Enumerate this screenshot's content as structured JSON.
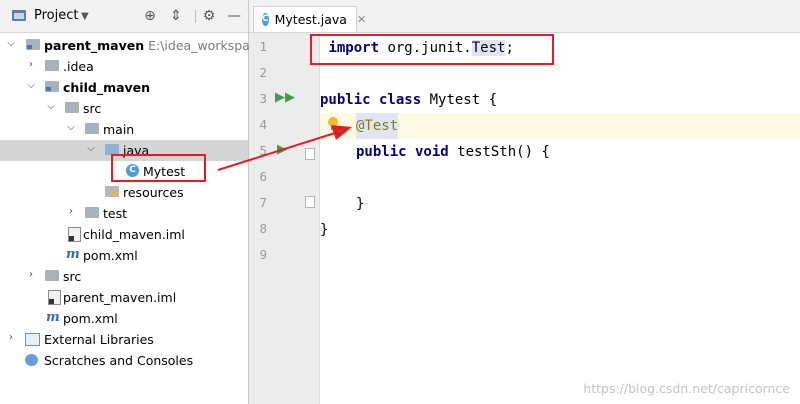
{
  "project_panel": {
    "title": "Project",
    "tree": [
      {
        "label": "parent_maven",
        "suffix": " E:\\idea_workspace\\",
        "bold": true
      },
      {
        "label": ".idea"
      },
      {
        "label": "child_maven",
        "bold": true
      },
      {
        "label": "src"
      },
      {
        "label": "main"
      },
      {
        "label": "java"
      },
      {
        "label": "Mytest"
      },
      {
        "label": "resources"
      },
      {
        "label": "test"
      },
      {
        "label": "child_maven.iml"
      },
      {
        "label": "pom.xml"
      },
      {
        "label": "src"
      },
      {
        "label": "parent_maven.iml"
      },
      {
        "label": "pom.xml"
      },
      {
        "label": "External Libraries"
      },
      {
        "label": "Scratches and Consoles"
      }
    ]
  },
  "editor": {
    "tab_label": "Mytest.java",
    "line_numbers": [
      "1",
      "2",
      "3",
      "4",
      "5",
      "6",
      "7",
      "8",
      "9"
    ],
    "code": {
      "l1_kw": "import",
      "l1_pkg": " org.junit.",
      "l1_cls": "Test",
      "l1_end": ";",
      "l3_kw": "public class",
      "l3_name": " Mytest {",
      "l4_ann": "@Test",
      "l5_kw": "public void",
      "l5_name": " testSth() {",
      "l7": "}",
      "l8": "}"
    }
  },
  "watermark": "https://blog.csdn.net/capricornce",
  "colors": {
    "annotation_red": "#e41d23",
    "keyword": "#000080",
    "annotation": "#808000"
  }
}
